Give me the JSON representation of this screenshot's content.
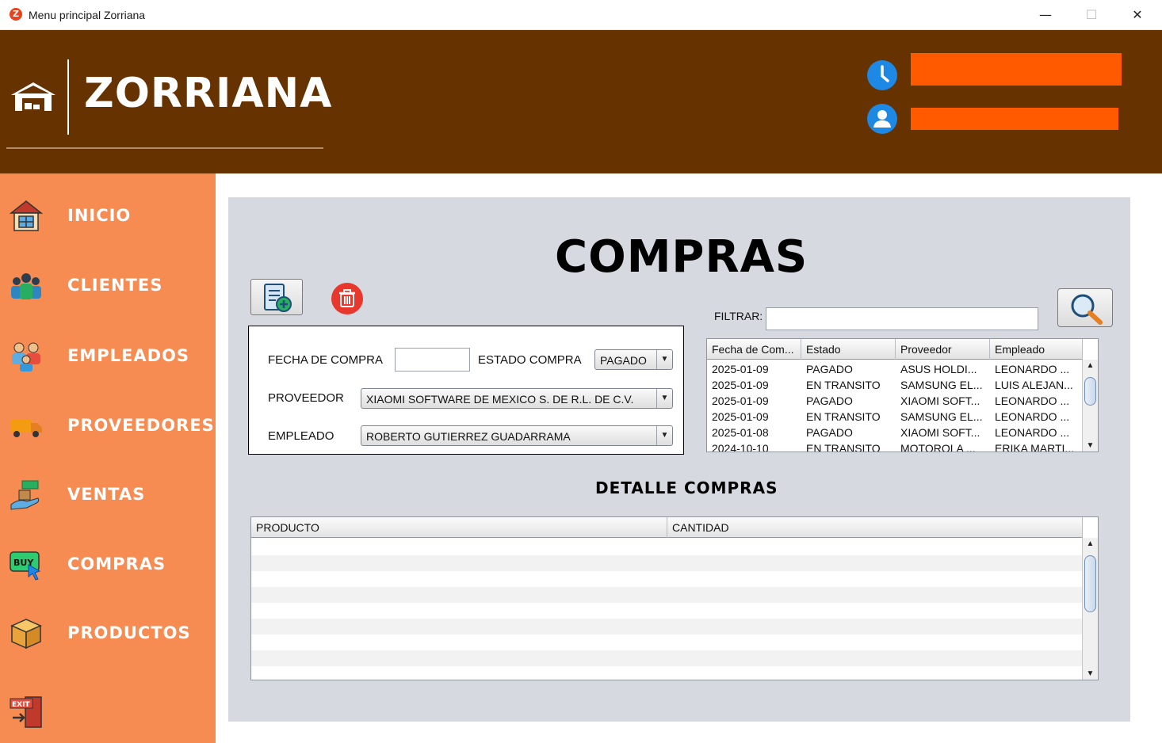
{
  "window": {
    "title": "Menu principal Zorriana",
    "app_icon": "Z",
    "minimize": "—",
    "maximize": "☐",
    "close": "✕"
  },
  "header": {
    "brand": "ZORRIANA",
    "icons": [
      "home-icon",
      "clock-icon",
      "user-icon"
    ],
    "colors": {
      "background": "#663300",
      "field": "#ff5a00"
    }
  },
  "sidebar": {
    "color": "#f78c52",
    "items": [
      {
        "label": "INICIO",
        "icon": "house-icon"
      },
      {
        "label": "CLIENTES",
        "icon": "clients-icon"
      },
      {
        "label": "EMPLEADOS",
        "icon": "employees-icon"
      },
      {
        "label": "PROVEEDORES",
        "icon": "truck-icon"
      },
      {
        "label": "VENTAS",
        "icon": "sales-icon"
      },
      {
        "label": "COMPRAS",
        "icon": "buy-icon"
      },
      {
        "label": "PRODUCTOS",
        "icon": "box-icon"
      }
    ],
    "exit_icon_text": "EXIT"
  },
  "main": {
    "title": "COMPRAS",
    "form": {
      "fecha_label": "FECHA DE COMPRA",
      "fecha_value": "",
      "estado_label": "ESTADO COMPRA",
      "estado_value": "PAGADO",
      "proveedor_label": "PROVEEDOR",
      "proveedor_value": "XIAOMI SOFTWARE DE MEXICO S. DE R.L. DE C.V.",
      "empleado_label": "EMPLEADO",
      "empleado_value": "ROBERTO GUTIERREZ GUADARRAMA"
    },
    "filter": {
      "label": "FILTRAR:",
      "value": ""
    },
    "purchases_table": {
      "columns": [
        "Fecha de Com...",
        "Estado",
        "Proveedor",
        "Empleado"
      ],
      "rows": [
        [
          "2025-01-09",
          "PAGADO",
          "ASUS HOLDI...",
          "LEONARDO ..."
        ],
        [
          "2025-01-09",
          "EN TRANSITO",
          "SAMSUNG EL...",
          "LUIS ALEJAN..."
        ],
        [
          "2025-01-09",
          "PAGADO",
          "XIAOMI SOFT...",
          "LEONARDO ..."
        ],
        [
          "2025-01-09",
          "EN TRANSITO",
          "SAMSUNG EL...",
          "LEONARDO ..."
        ],
        [
          "2025-01-08",
          "PAGADO",
          "XIAOMI SOFT...",
          "LEONARDO ..."
        ],
        [
          "2024-10-10",
          "EN TRANSITO",
          "MOTOROLA ...",
          "ERIKA MARTI..."
        ]
      ]
    },
    "detail": {
      "title": "DETALLE COMPRAS",
      "columns": [
        "PRODUCTO",
        "CANTIDAD"
      ],
      "rows": []
    }
  }
}
